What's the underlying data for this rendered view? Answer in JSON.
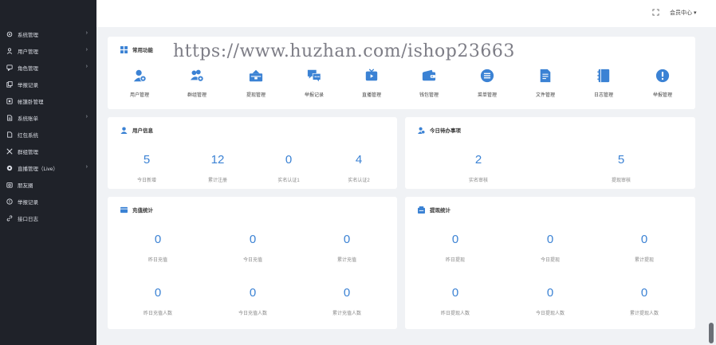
{
  "sidebar": {
    "items": [
      {
        "label": "系统管理",
        "icon": "gear-icon",
        "arrow": "›"
      },
      {
        "label": "用户管理",
        "icon": "user-icon",
        "arrow": "›"
      },
      {
        "label": "角色管理",
        "icon": "role-icon",
        "arrow": "›"
      },
      {
        "label": "举报记录",
        "icon": "report-icon",
        "arrow": ""
      },
      {
        "label": "帐篷卧管理",
        "icon": "box-icon",
        "arrow": ""
      },
      {
        "label": "系统账单",
        "icon": "bill-icon",
        "arrow": "›"
      },
      {
        "label": "红包系统",
        "icon": "redpacket-icon",
        "arrow": ""
      },
      {
        "label": "群组管理",
        "icon": "group-icon",
        "arrow": ""
      },
      {
        "label": "直播管理（Live）",
        "icon": "live-icon",
        "arrow": "›"
      },
      {
        "label": "朋友圈",
        "icon": "moments-icon",
        "arrow": ""
      },
      {
        "label": "举报记录",
        "icon": "alert-icon",
        "arrow": ""
      },
      {
        "label": "接口日志",
        "icon": "link-icon",
        "arrow": ""
      }
    ]
  },
  "header": {
    "member_center": "会员中心 ▾"
  },
  "watermark": "https://www.huzhan.com/ishop23663",
  "quick": {
    "title": "常用功能",
    "items": [
      {
        "label": "用户管理",
        "icon": "user-manage-icon"
      },
      {
        "label": "群组管理",
        "icon": "group-manage-icon"
      },
      {
        "label": "提现管理",
        "icon": "withdraw-icon"
      },
      {
        "label": "举报记录",
        "icon": "chat-report-icon"
      },
      {
        "label": "直播管理",
        "icon": "live-tv-icon"
      },
      {
        "label": "钱包管理",
        "icon": "wallet-icon"
      },
      {
        "label": "菜单管理",
        "icon": "menu-list-icon"
      },
      {
        "label": "文件管理",
        "icon": "file-icon"
      },
      {
        "label": "日志管理",
        "icon": "log-book-icon"
      },
      {
        "label": "举报管理",
        "icon": "warning-icon"
      }
    ]
  },
  "user_info": {
    "title": "用户信息",
    "stats": [
      {
        "value": "5",
        "label": "今日新增"
      },
      {
        "value": "12",
        "label": "累计注册"
      },
      {
        "value": "0",
        "label": "实名认证1"
      },
      {
        "value": "4",
        "label": "实名认证2"
      }
    ]
  },
  "todo": {
    "title": "今日待办事项",
    "stats": [
      {
        "value": "2",
        "label": "实名审核"
      },
      {
        "value": "5",
        "label": "提现审核"
      }
    ]
  },
  "recharge": {
    "title": "充值统计",
    "stats": [
      {
        "value": "0",
        "label": "昨日充值"
      },
      {
        "value": "0",
        "label": "今日充值"
      },
      {
        "value": "0",
        "label": "累计充值"
      },
      {
        "value": "0",
        "label": "昨日充值人数"
      },
      {
        "value": "0",
        "label": "今日充值人数"
      },
      {
        "value": "0",
        "label": "累计充值人数"
      }
    ]
  },
  "withdraw": {
    "title": "提现统计",
    "stats": [
      {
        "value": "0",
        "label": "昨日提现"
      },
      {
        "value": "0",
        "label": "今日提现"
      },
      {
        "value": "0",
        "label": "累计提现"
      },
      {
        "value": "0",
        "label": "昨日提现人数"
      },
      {
        "value": "0",
        "label": "今日提现人数"
      },
      {
        "value": "0",
        "label": "累计提现人数"
      }
    ]
  },
  "colors": {
    "accent": "#3b82d4",
    "sidebar_bg": "#1f2229",
    "page_bg": "#f0f2f5"
  }
}
